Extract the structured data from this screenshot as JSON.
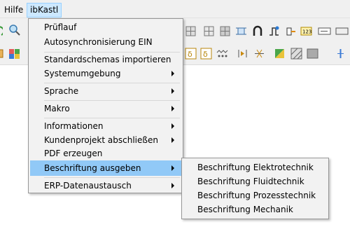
{
  "menubar": {
    "help_label": "Hilfe",
    "ibkastl_label": "ibKastl"
  },
  "menu": {
    "items": [
      {
        "label": "Prüflauf"
      },
      {
        "label": "Autosynchronisierung EIN"
      },
      {
        "label": "Standardschemas importieren"
      },
      {
        "label": "Systemumgebung"
      },
      {
        "label": "Sprache"
      },
      {
        "label": "Makro"
      },
      {
        "label": "Informationen"
      },
      {
        "label": "Kundenprojekt abschließen"
      },
      {
        "label": "PDF erzeugen"
      },
      {
        "label": "Beschriftung ausgeben"
      },
      {
        "label": "ERP-Datenaustausch"
      }
    ]
  },
  "submenu": {
    "items": [
      {
        "label": "Beschriftung Elektrotechnik"
      },
      {
        "label": "Beschriftung Fluidtechnik"
      },
      {
        "label": "Beschriftung Prozesstechnik"
      },
      {
        "label": "Beschriftung Mechanik"
      }
    ]
  },
  "colors": {
    "highlight": "#91c9f7",
    "menu_bg": "#f2f2f2",
    "toolbar_bg": "#f0f0f0",
    "active_menubar": "#cce8ff"
  }
}
